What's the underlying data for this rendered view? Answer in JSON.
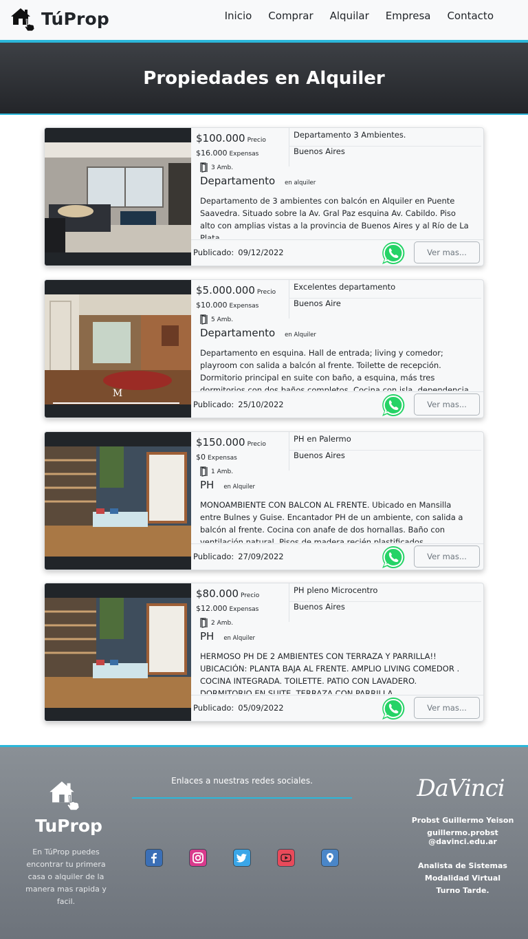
{
  "navbar": {
    "brand": "TúProp",
    "links": [
      "Inicio",
      "Comprar",
      "Alquilar",
      "Empresa",
      "Contacto"
    ]
  },
  "hero": {
    "title": "Propiedades en Alquiler"
  },
  "listings": [
    {
      "price": "$100.000",
      "price_label": "Precio",
      "expenses": "$16.000",
      "expenses_label": "Expensas",
      "rooms": "3 Amb.",
      "type": "Departamento",
      "status": "en alquiler",
      "title": "Departamento 3 Ambientes.",
      "city": "Buenos Aires",
      "description": "Departamento de 3 ambientes con balcón en Alquiler en Puente Saavedra. Situado sobre la Av. Gral Paz esquina Av. Cabildo. Piso alto con amplias vistas a la provincia de Buenos Aires y al Río de La Plata.",
      "published_label": "Publicado:",
      "published_date": "09/12/2022",
      "button": "Ver mas..."
    },
    {
      "price": "$5.000.000",
      "price_label": "Precio",
      "expenses": "$10.000",
      "expenses_label": "Expensas",
      "rooms": "5 Amb.",
      "type": "Departamento",
      "status": "en Alquiler",
      "title": "Excelentes departamento",
      "city": "Buenos Aire",
      "description": "Departamento en esquina. Hall de entrada; living y comedor; playroom con salida a balcón al frente. Toilette de recepción. Dormitorio principal en suite con baño, a esquina, más tres dormitorios con dos baños completos. Cocina con isla, dependencia de servicio con baño y",
      "published_label": "Publicado:",
      "published_date": "25/10/2022",
      "button": "Ver mas..."
    },
    {
      "price": "$150.000",
      "price_label": "Precio",
      "expenses": "$0",
      "expenses_label": "Expensas",
      "rooms": "1 Amb.",
      "type": "PH",
      "status": "en Alquiler",
      "title": "PH en Palermo",
      "city": "Buenos Aires",
      "description": "MONOAMBIENTE CON BALCON AL FRENTE. Ubicado en Mansilla entre Bulnes y Guise. Encantador PH de un ambiente, con salida a balcón al frente. Cocina con anafe de dos hornallas. Baño con ventilación natural. Pisos de madera recién plastificados.",
      "published_label": "Publicado:",
      "published_date": "27/09/2022",
      "button": "Ver mas..."
    },
    {
      "price": "$80.000",
      "price_label": "Precio",
      "expenses": "$12.000",
      "expenses_label": "Expensas",
      "rooms": "2 Amb.",
      "type": "PH",
      "status": "en Alquiler",
      "title": "PH pleno Microcentro",
      "city": "Buenos Aires",
      "description": "HERMOSO PH DE 2 AMBIENTES CON TERRAZA Y PARRILLA!! UBICACIÓN: PLANTA BAJA AL FRENTE. AMPLIO LIVING COMEDOR . COCINA INTEGRADA. TOILETTE. PATIO CON LAVADERO. DORMITORIO EN SUITE. TERRAZA CON PARRILLA.",
      "published_label": "Publicado:",
      "published_date": "05/09/2022",
      "button": "Ver mas..."
    }
  ],
  "footer": {
    "brand": "TuProp",
    "about": "En TúProp puedes encontrar tu primera casa o alquiler de la manera mas rapida y facil.",
    "social_title": "Enlaces a nuestras redes sociales.",
    "socials": [
      "facebook-icon",
      "instagram-icon",
      "twitter-icon",
      "youtube-icon",
      "location-icon"
    ],
    "logo": "DaVinci",
    "author_name": "Probst Guillermo Yeison",
    "author_email": "guillermo.probst @davinci.edu.ar",
    "info": [
      "Analista de Sistemas",
      "Modalidad Virtual",
      "Turno Tarde."
    ]
  },
  "colors": {
    "accent": "#2bb7da",
    "whatsapp": "#25d366",
    "hero_bg": "#2c2f33",
    "footer_bg": "#7a8088"
  }
}
